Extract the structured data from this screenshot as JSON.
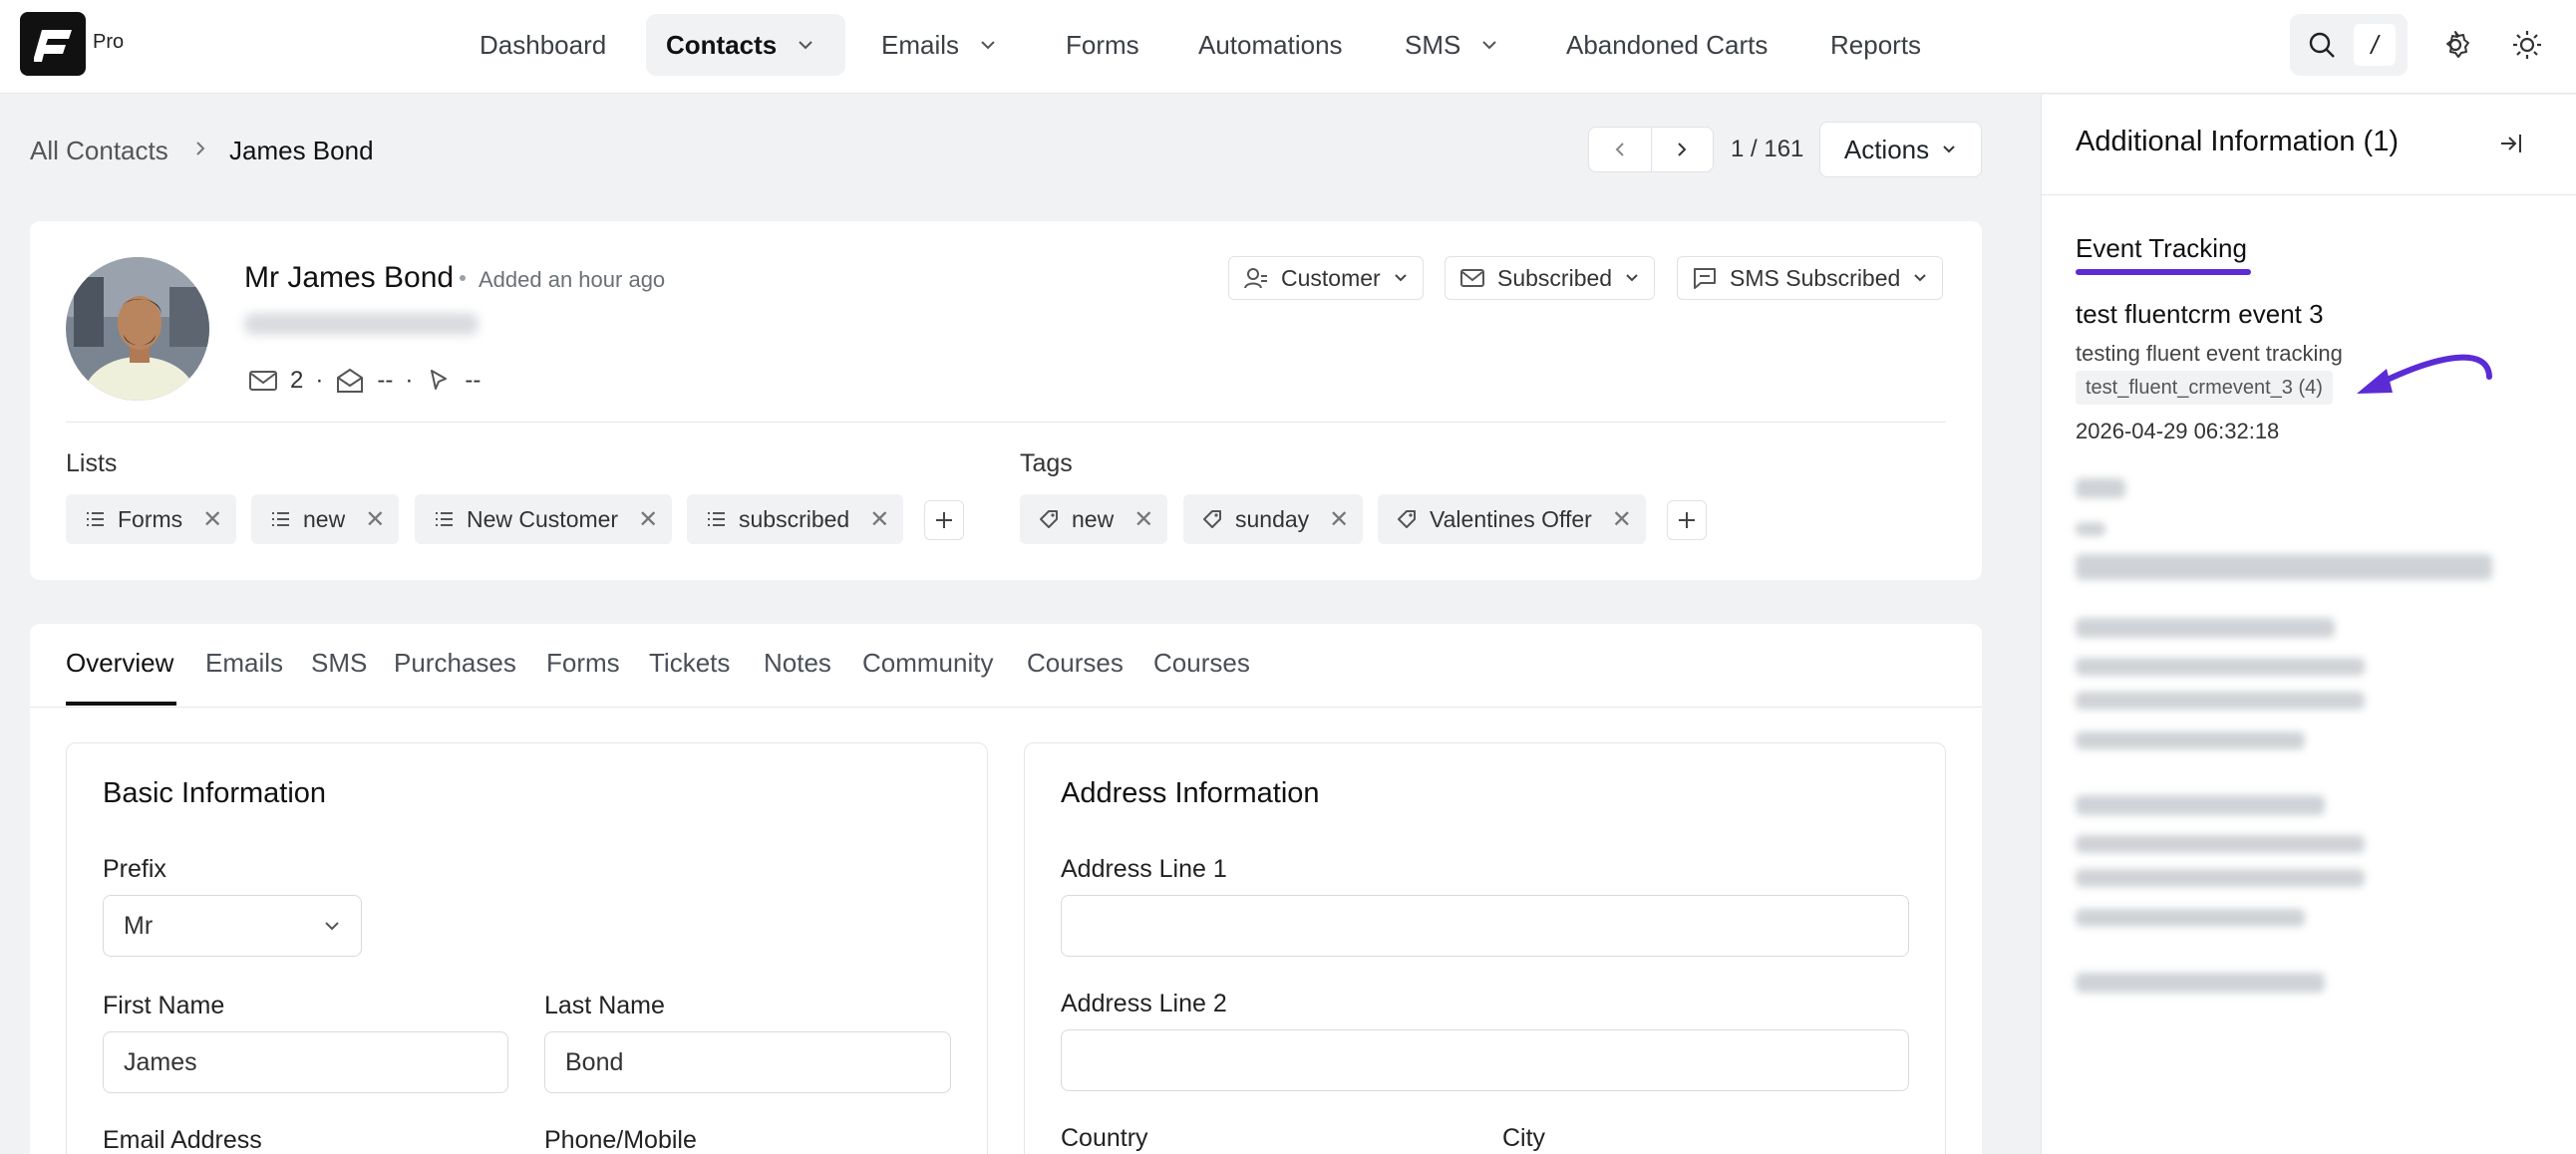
{
  "brand": {
    "badge": "Pro"
  },
  "nav": {
    "dashboard": "Dashboard",
    "contacts": "Contacts",
    "emails": "Emails",
    "forms": "Forms",
    "automations": "Automations",
    "sms": "SMS",
    "abandoned_carts": "Abandoned Carts",
    "reports": "Reports",
    "shortcut_key": "/"
  },
  "breadcrumb": {
    "parent": "All Contacts",
    "current": "James Bond"
  },
  "pager": {
    "count": "1 / 161"
  },
  "actions": {
    "label": "Actions"
  },
  "contact": {
    "name": "Mr James Bond",
    "added": "Added an hour ago",
    "emails_sent": "2",
    "opens": "--",
    "clicks": "--",
    "stat_sep": "·"
  },
  "statuses": {
    "type": "Customer",
    "email": "Subscribed",
    "sms": "SMS Subscribed"
  },
  "lists": {
    "label": "Lists",
    "items": [
      "Forms",
      "new",
      "New Customer",
      "subscribed"
    ]
  },
  "tags": {
    "label": "Tags",
    "items": [
      "new",
      "sunday",
      "Valentines Offer"
    ]
  },
  "tabs": [
    "Overview",
    "Emails",
    "SMS",
    "Purchases",
    "Forms",
    "Tickets",
    "Notes",
    "Community",
    "Courses",
    "Courses"
  ],
  "basic_info": {
    "title": "Basic Information",
    "prefix_label": "Prefix",
    "prefix_value": "Mr",
    "first_name_label": "First Name",
    "first_name_value": "James",
    "last_name_label": "Last Name",
    "last_name_value": "Bond",
    "email_label": "Email Address",
    "phone_label": "Phone/Mobile"
  },
  "address_info": {
    "title": "Address Information",
    "line1_label": "Address Line 1",
    "line2_label": "Address Line 2",
    "country_label": "Country",
    "city_label": "City"
  },
  "sidebar": {
    "title": "Additional Information (1)",
    "tab": "Event Tracking",
    "event": {
      "name": "test fluentcrm event 3",
      "description": "testing fluent event tracking",
      "key": "test_fluent_crmevent_3",
      "count": "(4)",
      "timestamp": "2026-04-29 06:32:18"
    }
  },
  "colors": {
    "accent": "#5b2bd6",
    "brand_dark": "#111111"
  },
  "icons": [
    "search-icon",
    "gear-icon",
    "sun-icon",
    "chevron-down-icon",
    "chevron-left-icon",
    "chevron-right-icon",
    "list-icon",
    "tag-icon",
    "close-icon",
    "plus-icon",
    "mail-icon",
    "mail-open-icon",
    "cursor-icon",
    "user-icon",
    "message-icon",
    "collapse-panel-icon",
    "arrow-icon"
  ]
}
